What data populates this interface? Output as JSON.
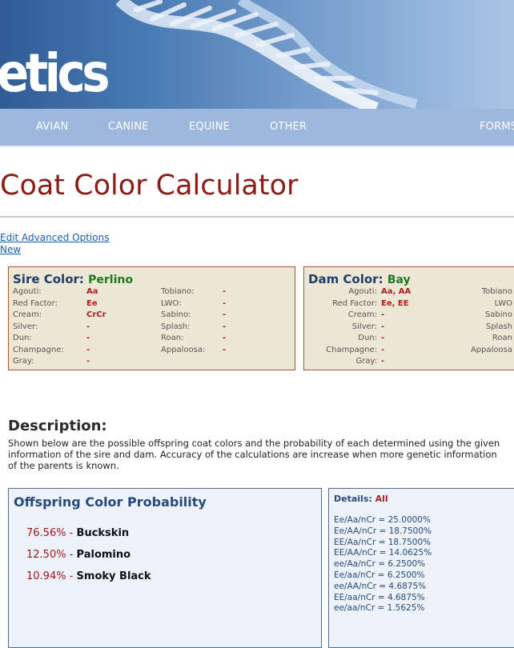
{
  "banner": {
    "logo_text": "etics"
  },
  "nav": {
    "items": [
      "AVIAN",
      "CANINE",
      "EQUINE",
      "OTHER",
      "FORMS"
    ]
  },
  "page_title": "Coat Color Calculator",
  "links": {
    "advanced": "Edit Advanced Options",
    "new": "New"
  },
  "sire": {
    "heading": "Sire Color:",
    "color": "Perlino",
    "left": [
      {
        "label": "Agouti:",
        "value": "Aa"
      },
      {
        "label": "Red Factor:",
        "value": "Ee"
      },
      {
        "label": "Cream:",
        "value": "CrCr"
      },
      {
        "label": "Silver:",
        "value": "-"
      },
      {
        "label": "Dun:",
        "value": "-"
      },
      {
        "label": "Champagne:",
        "value": "-"
      },
      {
        "label": "Gray:",
        "value": "-"
      }
    ],
    "right": [
      {
        "label": "Tobiano:",
        "value": "-"
      },
      {
        "label": "LWO:",
        "value": "-"
      },
      {
        "label": "Sabino:",
        "value": "-"
      },
      {
        "label": "Splash:",
        "value": "-"
      },
      {
        "label": "Roan:",
        "value": "-"
      },
      {
        "label": "Appaloosa:",
        "value": "-"
      }
    ]
  },
  "dam": {
    "heading": "Dam Color:",
    "color": "Bay",
    "left": [
      {
        "label": "Agouti:",
        "value": "Aa, AA"
      },
      {
        "label": "Red Factor:",
        "value": "Ee, EE"
      },
      {
        "label": "Cream:",
        "value": "-"
      },
      {
        "label": "Silver:",
        "value": "-"
      },
      {
        "label": "Dun:",
        "value": "-"
      },
      {
        "label": "Champagne:",
        "value": "-"
      },
      {
        "label": "Gray:",
        "value": "-"
      }
    ],
    "right": [
      {
        "label": "Tobiano"
      },
      {
        "label": "LWO"
      },
      {
        "label": "Sabino"
      },
      {
        "label": "Splash"
      },
      {
        "label": "Roan"
      },
      {
        "label": "Appaloosa"
      }
    ]
  },
  "description": {
    "title": "Description:",
    "text": "Shown below are the possible offspring coat colors and the probability of each determined using the given information of the sire and dam. Accuracy of the calculations are increase when more genetic information of the parents is known."
  },
  "offspring": {
    "title": "Offspring Color Probability",
    "items": [
      {
        "pct": "76.56% -",
        "name": "Buckskin"
      },
      {
        "pct": "12.50% -",
        "name": "Palomino"
      },
      {
        "pct": "10.94% -",
        "name": "Smoky Black"
      }
    ]
  },
  "details": {
    "label": "Details:",
    "filter": "All",
    "lines": [
      "Ee/Aa/nCr = 25.0000%",
      "Ee/AA/nCr = 18.7500%",
      "EE/Aa/nCr = 18.7500%",
      "EE/AA/nCr = 14.0625%",
      "ee/Aa/nCr = 6.2500%",
      "Ee/aa/nCr = 6.2500%",
      "ee/AA/nCr = 4.6875%",
      "EE/aa/nCr = 4.6875%",
      "ee/aa/nCr = 1.5625%"
    ]
  },
  "colors": {
    "title_red": "#8b1b16",
    "heading_blue": "#1f3d6a",
    "value_green": "#1c7a1c",
    "value_red": "#b01c1c",
    "panel_bg": "#ece8d5",
    "nav_bg": "#9db8dc"
  }
}
